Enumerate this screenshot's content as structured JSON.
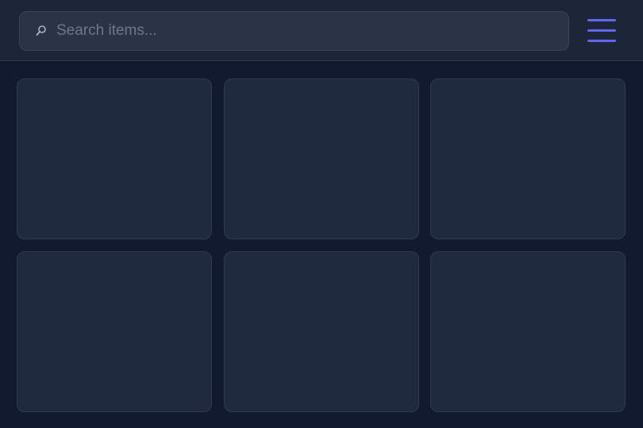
{
  "search": {
    "placeholder": "Search items...",
    "value": "",
    "icon": "search-icon"
  },
  "menu": {
    "icon": "hamburger-menu-icon",
    "accent_color": "#6366f1"
  },
  "grid": {
    "items": [
      {
        "index": 1
      },
      {
        "index": 2
      },
      {
        "index": 3
      },
      {
        "index": 4
      },
      {
        "index": 5
      },
      {
        "index": 6
      }
    ]
  }
}
